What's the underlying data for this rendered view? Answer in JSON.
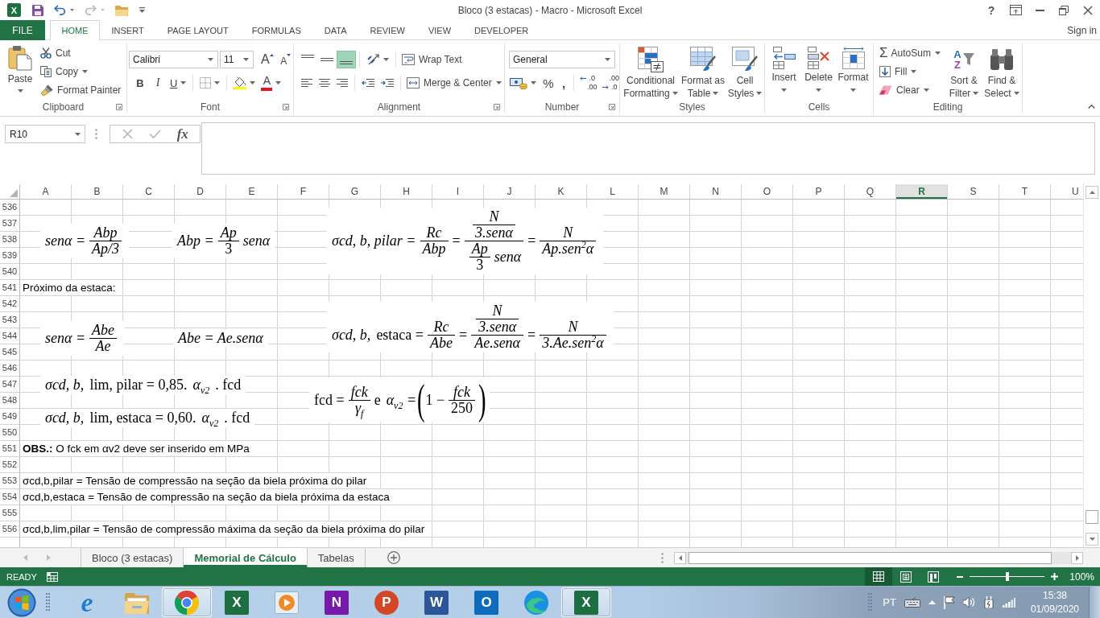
{
  "title_bar": {
    "app_letter": "X",
    "quick_access": [
      {
        "kind": "save",
        "disabled": false
      },
      {
        "kind": "undo",
        "disabled": false
      },
      {
        "kind": "redo",
        "disabled": true
      },
      {
        "kind": "open",
        "disabled": false
      }
    ],
    "title": "Bloco (3 estacas) - Macro - Microsoft Excel",
    "help": "?"
  },
  "ribbon_tabs": [
    {
      "label": "FILE",
      "kind": "file",
      "selected": false
    },
    {
      "label": "HOME",
      "kind": "tab",
      "selected": true
    },
    {
      "label": "INSERT",
      "kind": "tab",
      "selected": false
    },
    {
      "label": "PAGE LAYOUT",
      "kind": "tab",
      "selected": false
    },
    {
      "label": "FORMULAS",
      "kind": "tab",
      "selected": false
    },
    {
      "label": "DATA",
      "kind": "tab",
      "selected": false
    },
    {
      "label": "REVIEW",
      "kind": "tab",
      "selected": false
    },
    {
      "label": "VIEW",
      "kind": "tab",
      "selected": false
    },
    {
      "label": "DEVELOPER",
      "kind": "tab",
      "selected": false
    }
  ],
  "account": {
    "label": "Sign in"
  },
  "ribbon": {
    "clipboard": {
      "title": "Clipboard",
      "paste": "Paste",
      "cut": "Cut",
      "copy": "Copy",
      "format_painter": "Format Painter"
    },
    "font": {
      "title": "Font",
      "name": "Calibri",
      "size": "11",
      "grow": "A",
      "shrink": "A",
      "bold": "B",
      "italic": "I",
      "underline": "U",
      "font_color": "A"
    },
    "alignment": {
      "title": "Alignment",
      "align_buttons": [
        {
          "kind": "top",
          "selected": false
        },
        {
          "kind": "middle",
          "selected": false
        },
        {
          "kind": "bottom",
          "selected": true
        },
        {
          "kind": "left",
          "selected": false
        },
        {
          "kind": "center",
          "selected": false
        },
        {
          "kind": "right",
          "selected": false
        }
      ],
      "wrap_text": "Wrap Text",
      "merge_center": "Merge & Center"
    },
    "number": {
      "title": "Number",
      "format": "General",
      "percent": "%",
      "comma": ",",
      "decimals": [
        {
          "kind": "increase",
          "top": ".0",
          "bottom": ".00"
        },
        {
          "kind": "decrease",
          "top": ".00",
          "bottom": ".0"
        }
      ]
    },
    "styles": {
      "title": "Styles",
      "buttons": [
        {
          "kind": "conditional",
          "label": "Conditional Formatting"
        },
        {
          "kind": "table",
          "label": "Format as Table"
        },
        {
          "kind": "cell",
          "label": "Cell Styles"
        }
      ]
    },
    "cells": {
      "title": "Cells",
      "buttons": [
        {
          "kind": "insert",
          "label": "Insert"
        },
        {
          "kind": "delete",
          "label": "Delete"
        },
        {
          "kind": "format",
          "label": "Format"
        }
      ]
    },
    "editing": {
      "title": "Editing",
      "autosum_symbol": "Σ",
      "autosum": "AutoSum",
      "fill": "Fill",
      "clear": "Clear",
      "sort_letters": [
        "A",
        "Z"
      ],
      "sort_filter": "Sort & Filter",
      "find_select": "Find & Select"
    }
  },
  "formula_bar": {
    "name_box": "R10",
    "buttons": [
      {
        "kind": "cancel",
        "disabled": true
      },
      {
        "kind": "enter",
        "disabled": true
      }
    ],
    "function_label": "fx"
  },
  "sheet": {
    "columns": [
      {
        "label": "A",
        "selected": false
      },
      {
        "label": "B",
        "selected": false
      },
      {
        "label": "C",
        "selected": false
      },
      {
        "label": "D",
        "selected": false
      },
      {
        "label": "E",
        "selected": false
      },
      {
        "label": "F",
        "selected": false
      },
      {
        "label": "G",
        "selected": false
      },
      {
        "label": "H",
        "selected": false
      },
      {
        "label": "I",
        "selected": false
      },
      {
        "label": "J",
        "selected": false
      },
      {
        "label": "K",
        "selected": false
      },
      {
        "label": "L",
        "selected": false
      },
      {
        "label": "M",
        "selected": false
      },
      {
        "label": "N",
        "selected": false
      },
      {
        "label": "O",
        "selected": false
      },
      {
        "label": "P",
        "selected": false
      },
      {
        "label": "Q",
        "selected": false
      },
      {
        "label": "R",
        "selected": true
      },
      {
        "label": "S",
        "selected": false
      },
      {
        "label": "T",
        "selected": false
      },
      {
        "label": "U",
        "selected": false
      }
    ],
    "rows": [
      {
        "number": "536"
      },
      {
        "number": "537"
      },
      {
        "number": "538"
      },
      {
        "number": "539"
      },
      {
        "number": "540"
      },
      {
        "number": "541",
        "text": "Próximo da estaca:"
      },
      {
        "number": "542"
      },
      {
        "number": "543"
      },
      {
        "number": "544"
      },
      {
        "number": "545"
      },
      {
        "number": "546"
      },
      {
        "number": "547"
      },
      {
        "number": "548"
      },
      {
        "number": "549"
      },
      {
        "number": "550"
      },
      {
        "number": "551",
        "text": "**OBS.:** O fck em αv2 deve ser inserido em MPa"
      },
      {
        "number": "552"
      },
      {
        "number": "553",
        "text": "σcd,b,pilar = Tensão de compressão na seção da biela próxima do pilar"
      },
      {
        "number": "554",
        "text": "σcd,b,estaca = Tensão de compressão na seção da biela próxima da estaca"
      },
      {
        "number": "555"
      },
      {
        "number": "556",
        "text": "σcd,b,lim,pilar = Tensão de compressão máxima da seção da biela próxima do pilar"
      }
    ],
    "equations": [
      {
        "parts": [
          {
            "kind": "text",
            "text": "senα =",
            "italic": true
          },
          {
            "kind": "frac",
            "num": [
              {
                "kind": "text",
                "text": "Abp",
                "italic": true
              }
            ],
            "den": [
              {
                "kind": "text",
                "text": "Ap/3",
                "italic": true
              }
            ]
          }
        ]
      },
      {
        "parts": [
          {
            "kind": "text",
            "text": "Abp =",
            "italic": true
          },
          {
            "kind": "frac",
            "num": [
              {
                "kind": "text",
                "text": "Ap",
                "italic": true
              }
            ],
            "den": [
              {
                "kind": "text",
                "text": "3",
                "italic": false
              }
            ]
          },
          {
            "kind": "text",
            "text": "senα",
            "italic": true
          }
        ]
      },
      {
        "parts": [
          {
            "kind": "text",
            "text": "σcd, b, pilar =",
            "italic": true
          },
          {
            "kind": "frac",
            "num": [
              {
                "kind": "text",
                "text": "Rc",
                "italic": true
              }
            ],
            "den": [
              {
                "kind": "text",
                "text": "Abp",
                "italic": true
              }
            ]
          },
          {
            "kind": "text",
            "text": "=",
            "italic": false
          },
          {
            "kind": "frac",
            "num": [
              {
                "kind": "frac",
                "num": [
                  {
                    "kind": "text",
                    "text": "N",
                    "italic": true
                  }
                ],
                "den": [
                  {
                    "kind": "text",
                    "text": "3.senα",
                    "italic": true
                  }
                ]
              }
            ],
            "den": [
              {
                "kind": "frac",
                "num": [
                  {
                    "kind": "text",
                    "text": "Ap",
                    "italic": true
                  }
                ],
                "den": [
                  {
                    "kind": "text",
                    "text": "3",
                    "italic": false
                  }
                ]
              },
              {
                "kind": "text",
                "text": "senα",
                "italic": true
              }
            ]
          },
          {
            "kind": "text",
            "text": "=",
            "italic": false
          },
          {
            "kind": "frac",
            "num": [
              {
                "kind": "text",
                "text": "N",
                "italic": true
              }
            ],
            "den": [
              {
                "kind": "text",
                "text": "Ap.sen$^{2}$α",
                "italic": true
              }
            ]
          }
        ]
      },
      {
        "parts": [
          {
            "kind": "text",
            "text": "senα =",
            "italic": true
          },
          {
            "kind": "frac",
            "num": [
              {
                "kind": "text",
                "text": "Abe",
                "italic": true
              }
            ],
            "den": [
              {
                "kind": "text",
                "text": "Ae",
                "italic": true
              }
            ]
          }
        ]
      },
      {
        "parts": [
          {
            "kind": "text",
            "text": "Abe = Ae.senα",
            "italic": true
          }
        ]
      },
      {
        "parts": [
          {
            "kind": "text",
            "text": "σcd, b,",
            "italic": true
          },
          {
            "kind": "text",
            "text": "estaca =",
            "italic": false
          },
          {
            "kind": "frac",
            "num": [
              {
                "kind": "text",
                "text": "Rc",
                "italic": true
              }
            ],
            "den": [
              {
                "kind": "text",
                "text": "Abe",
                "italic": true
              }
            ]
          },
          {
            "kind": "text",
            "text": "=",
            "italic": false
          },
          {
            "kind": "frac",
            "num": [
              {
                "kind": "frac",
                "num": [
                  {
                    "kind": "text",
                    "text": "N",
                    "italic": true
                  }
                ],
                "den": [
                  {
                    "kind": "text",
                    "text": "3.senα",
                    "italic": true
                  }
                ]
              }
            ],
            "den": [
              {
                "kind": "text",
                "text": "Ae.senα",
                "italic": true
              }
            ]
          },
          {
            "kind": "text",
            "text": "=",
            "italic": false
          },
          {
            "kind": "frac",
            "num": [
              {
                "kind": "text",
                "text": "N",
                "italic": true
              }
            ],
            "den": [
              {
                "kind": "text",
                "text": "3.Ae.sen$^{2}$α",
                "italic": true
              }
            ]
          }
        ]
      },
      {
        "parts": [
          {
            "kind": "text",
            "text": "σcd, b,",
            "italic": true
          },
          {
            "kind": "text",
            "text": "lim, pilar = 0,85.",
            "italic": false
          },
          {
            "kind": "text",
            "text": "α$_{v2}$",
            "italic": true
          },
          {
            "kind": "text",
            "text": ". fcd",
            "italic": false
          }
        ]
      },
      {
        "parts": [
          {
            "kind": "text",
            "text": "σcd, b,",
            "italic": true
          },
          {
            "kind": "text",
            "text": "lim, estaca = 0,60.",
            "italic": false
          },
          {
            "kind": "text",
            "text": "α$_{v2}$",
            "italic": true
          },
          {
            "kind": "text",
            "text": ". fcd",
            "italic": false
          }
        ]
      },
      {
        "parts": [
          {
            "kind": "text",
            "text": "fcd =",
            "italic": false
          },
          {
            "kind": "frac",
            "num": [
              {
                "kind": "text",
                "text": "fck",
                "italic": true
              }
            ],
            "den": [
              {
                "kind": "text",
                "text": "γ$_{f}$",
                "italic": true
              }
            ]
          },
          {
            "kind": "text",
            "text": "e",
            "italic": false
          },
          {
            "kind": "text",
            "text": "α$_{v2}$ =",
            "italic": true
          },
          {
            "kind": "paren",
            "open": "(",
            "body": [
              {
                "kind": "text",
                "text": "1 −",
                "italic": false
              },
              {
                "kind": "frac",
                "num": [
                  {
                    "kind": "text",
                    "text": "fck",
                    "italic": true
                  }
                ],
                "den": [
                  {
                    "kind": "text",
                    "text": "250",
                    "italic": false
                  }
                ]
              }
            ],
            "close": ")"
          }
        ]
      }
    ]
  },
  "sheet_tabs": {
    "navigation": [
      {
        "kind": "previous",
        "disabled": true
      },
      {
        "kind": "next",
        "disabled": true
      }
    ],
    "tabs": [
      {
        "label": "Bloco (3 estacas)",
        "selected": false
      },
      {
        "label": "Memorial de Cálculo",
        "selected": true
      },
      {
        "label": "Tabelas",
        "selected": false
      }
    ]
  },
  "status_bar": {
    "status": "READY",
    "views": [
      {
        "kind": "normal",
        "selected": true
      },
      {
        "kind": "page_layout",
        "selected": false
      },
      {
        "kind": "page_break",
        "selected": false
      }
    ],
    "zoom": {
      "level": 0.5,
      "label": "100%"
    }
  },
  "taskbar": {
    "apps": [
      {
        "kind": "ie",
        "letter": "e",
        "active": false
      },
      {
        "kind": "explorer",
        "active": false
      },
      {
        "kind": "chrome",
        "active": true
      },
      {
        "kind": "excel",
        "letter": "X",
        "active": false
      },
      {
        "kind": "media",
        "active": false
      },
      {
        "kind": "onenote",
        "letter": "N",
        "active": false
      },
      {
        "kind": "powerpoint",
        "letter": "P",
        "active": false
      },
      {
        "kind": "word",
        "letter": "W",
        "active": false
      },
      {
        "kind": "outlook",
        "letter": "O",
        "active": false
      },
      {
        "kind": "edge",
        "active": false
      },
      {
        "kind": "excel",
        "letter": "X",
        "active": true
      }
    ],
    "language": "PT",
    "time": "15:38",
    "date": "01/09/2020"
  }
}
